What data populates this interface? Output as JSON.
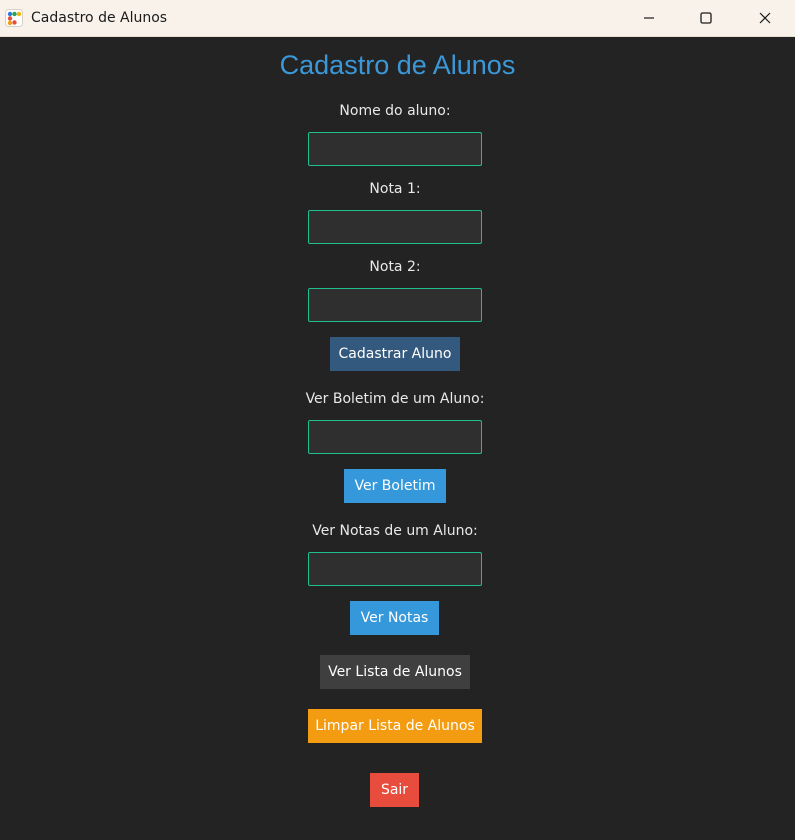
{
  "window": {
    "title": "Cadastro de Alunos"
  },
  "form": {
    "heading": "Cadastro de Alunos",
    "nome_label": "Nome do aluno:",
    "nome_value": "",
    "nota1_label": "Nota 1:",
    "nota1_value": "",
    "nota2_label": "Nota 2:",
    "nota2_value": "",
    "cadastrar_button": "Cadastrar Aluno",
    "boletim_label": "Ver Boletim de um Aluno:",
    "boletim_value": "",
    "ver_boletim_button": "Ver Boletim",
    "notas_label": "Ver Notas de um Aluno:",
    "notas_value": "",
    "ver_notas_button": "Ver Notas",
    "lista_button": "Ver Lista de Alunos",
    "limpar_button": "Limpar Lista de Alunos",
    "sair_button": "Sair"
  },
  "colors": {
    "background": "#232323",
    "heading": "#3b98d8",
    "field_border": "#1fbf8f",
    "cadastrar": "#34597e",
    "ver_boletim": "#3498db",
    "ver_notas": "#3498db",
    "lista": "#3f3f3f",
    "limpar": "#f39c12",
    "sair": "#e74c3c"
  },
  "icons": {
    "app": "app-icon",
    "minimize": "minimize-icon",
    "maximize": "maximize-icon",
    "close": "close-icon"
  }
}
